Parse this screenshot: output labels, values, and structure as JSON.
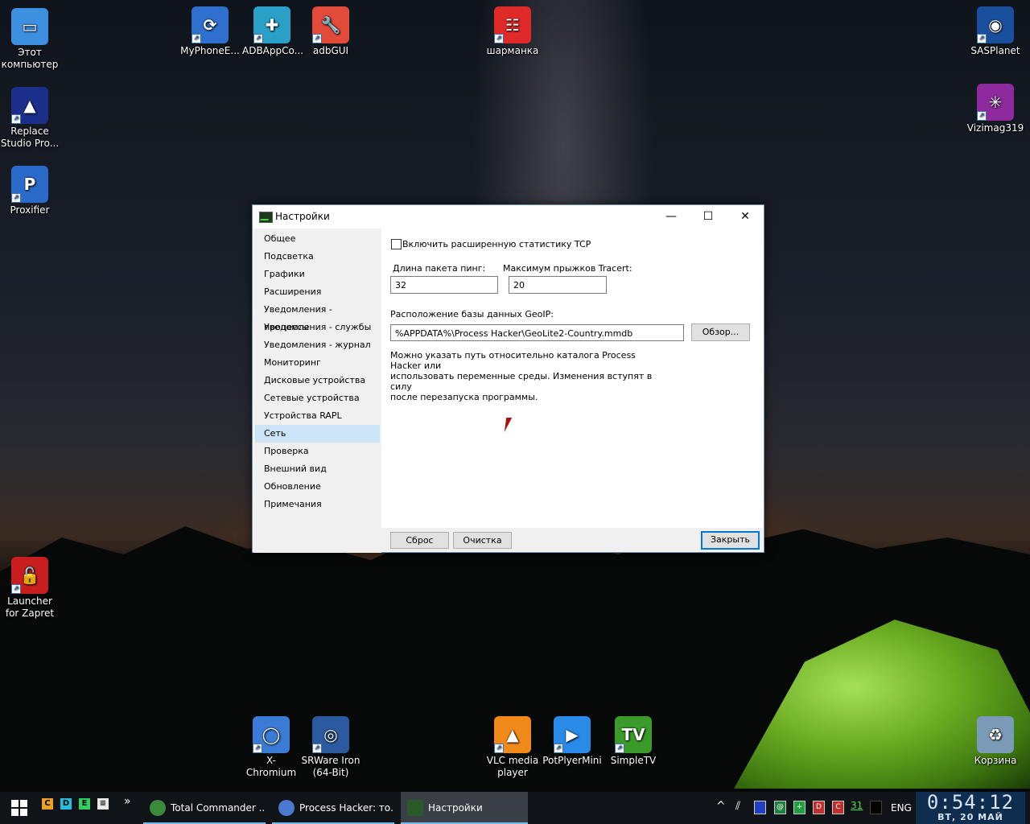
{
  "desktop": {
    "icons": [
      {
        "label": "Этот компьютер",
        "color": "#3d8fe0",
        "glyph": "▭"
      },
      {
        "label": "MyPhoneE...",
        "color": "#2f6fce",
        "glyph": "⟳"
      },
      {
        "label": "ADBAppCo...",
        "color": "#2aa0c8",
        "glyph": "✚"
      },
      {
        "label": "adbGUI",
        "color": "#e24a3a",
        "glyph": "🔧"
      },
      {
        "label": "шарманка",
        "color": "#e02a2a",
        "glyph": "☷"
      },
      {
        "label": "SASPlanet",
        "color": "#1a4f9e",
        "glyph": "◉"
      },
      {
        "label": "Replace Studio Pro...",
        "color": "#1c2f8a",
        "glyph": "▲"
      },
      {
        "label": "Vizimag319",
        "color": "#8d2a9e",
        "glyph": "✳"
      },
      {
        "label": "Proxifier",
        "color": "#2a6ac8",
        "glyph": "P"
      },
      {
        "label": "Launcher for Zapret",
        "color": "#c81e1e",
        "glyph": "🔓"
      },
      {
        "label": "X-Chromium",
        "color": "#3a7bd5",
        "glyph": "◯"
      },
      {
        "label": "SRWare Iron (64-Bit)",
        "color": "#2c5aa0",
        "glyph": "◎"
      },
      {
        "label": "VLC media player",
        "color": "#f08a1a",
        "glyph": "▲"
      },
      {
        "label": "PotPlyerMini",
        "color": "#2a8ae8",
        "glyph": "▶"
      },
      {
        "label": "SimpleTV",
        "color": "#3a9a2a",
        "glyph": "TV"
      },
      {
        "label": "Корзина",
        "color": "#7a9ab8",
        "glyph": "♻"
      }
    ]
  },
  "window": {
    "title": "Настройки",
    "minimize_glyph": "—",
    "maximize_glyph": "☐",
    "close_glyph": "✕",
    "sidebar": [
      "Общее",
      "Подсветка",
      "Графики",
      "Расширения",
      "Уведомления - процессы",
      "Уведомления - службы",
      "Уведомления - журнал",
      "Мониторинг",
      "Дисковые устройства",
      "Сетевые устройства",
      "Устройства RAPL",
      "Сеть",
      "Проверка",
      "Внешний вид",
      "Обновление",
      "Примечания"
    ],
    "selected_index": 11,
    "content": {
      "tcp_checkbox_label": "Включить расширенную статистику TCP",
      "tcp_checked": false,
      "ping_label": "Длина пакета пинг:",
      "ping_value": "32",
      "tracert_label": "Максимум прыжков Tracert:",
      "tracert_value": "20",
      "geoip_label": "Расположение базы данных GeoIP:",
      "geoip_value": "%APPDATA%\\Process Hacker\\GeoLite2-Country.mmdb",
      "browse_label": "Обзор...",
      "note_line1": "Можно указать путь относительно каталога Process Hacker или",
      "note_line2": "использовать переменные среды. Изменения вступят в силу",
      "note_line3": "после перезапуска программы."
    },
    "footer": {
      "reset_label": "Сброс",
      "clear_label": "Очистка",
      "close_label": "Закрыть"
    }
  },
  "taskbar": {
    "quick": [
      {
        "glyph": "C",
        "color": "#f0a020"
      },
      {
        "glyph": "D",
        "color": "#20c0e0"
      },
      {
        "glyph": "E",
        "color": "#30d060"
      },
      {
        "glyph": "≡",
        "color": "#e8e8e8"
      }
    ],
    "overflow_glyph": "»",
    "tasks": [
      {
        "label": "Total Commander ...",
        "color": "#3a8a3a"
      },
      {
        "label": "Process Hacker: то...",
        "color": "#4a7ad0"
      },
      {
        "label": "Настройки",
        "color": "#2a5a2a"
      }
    ],
    "tray": {
      "chevron": "^",
      "lang": "ENG",
      "day_number": "31"
    },
    "clock": {
      "time": "0:54:12",
      "date": "ВТ, 20 МАЙ"
    }
  }
}
